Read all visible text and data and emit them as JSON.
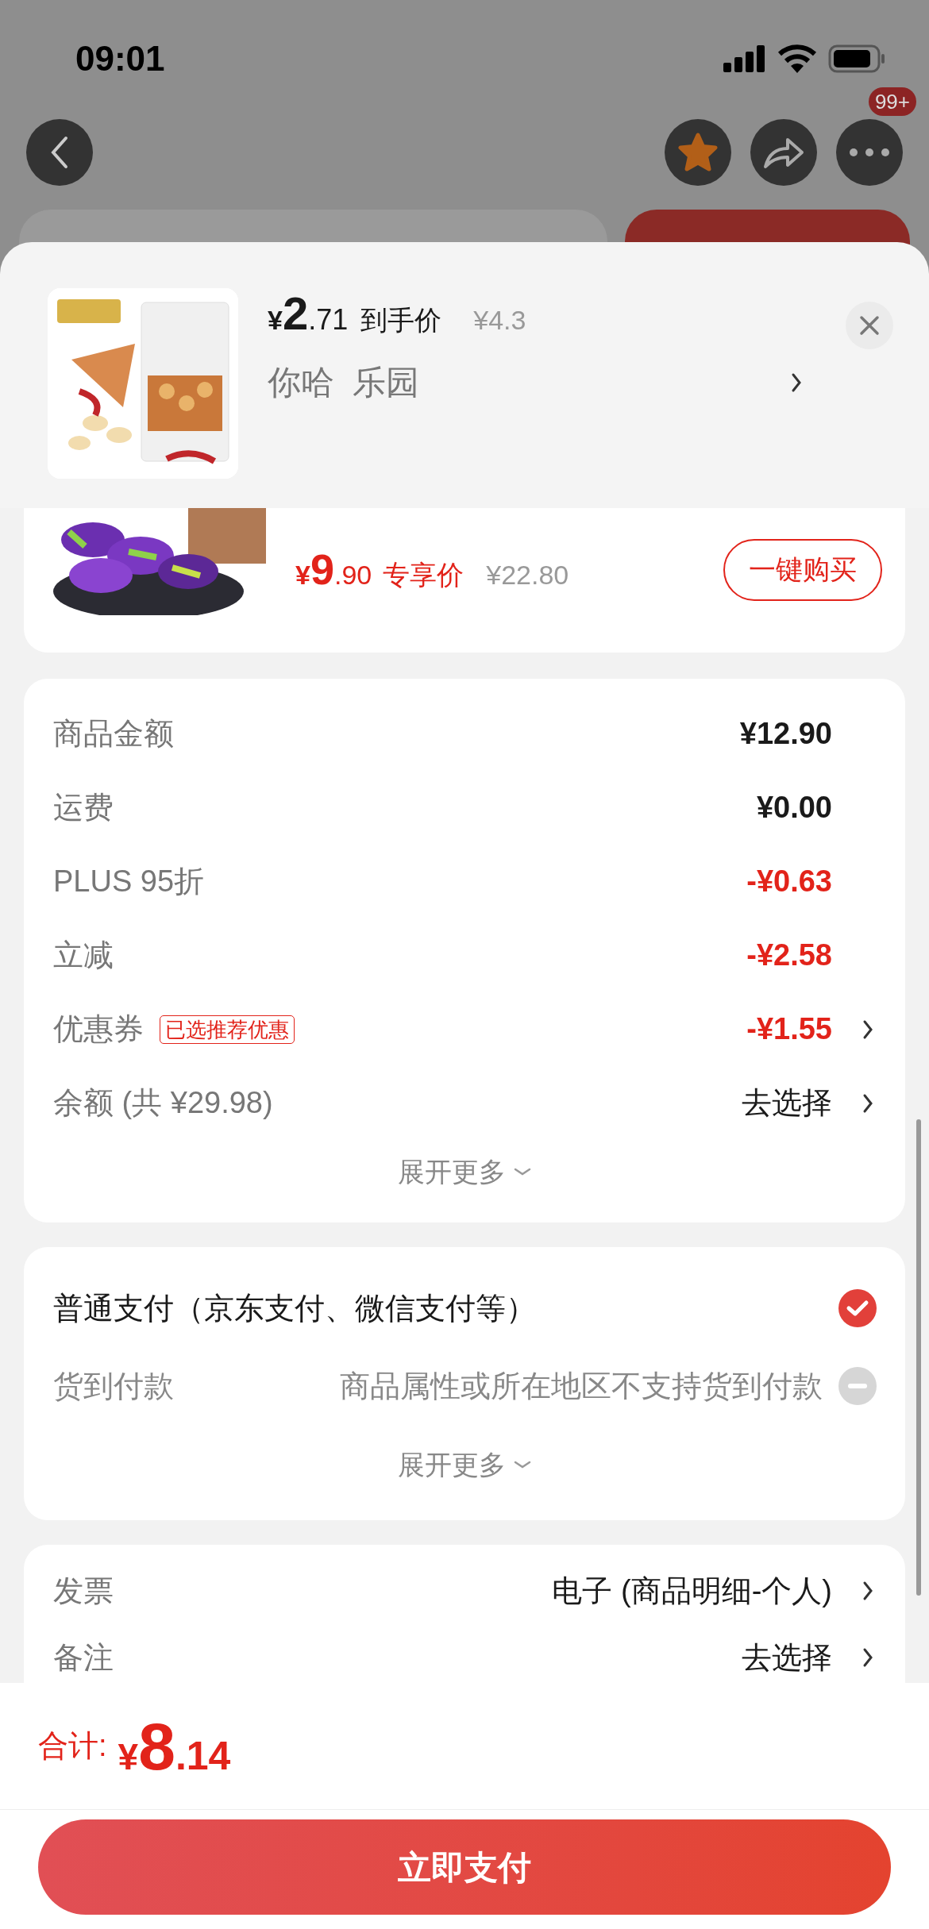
{
  "status_bar": {
    "time": "09:01"
  },
  "nav": {
    "badge": "99+"
  },
  "product": {
    "currency": "¥",
    "price_int": "2",
    "price_dec": ".71",
    "price_label": "到手价",
    "original_price": "¥4.3",
    "name": "你哈  乐园"
  },
  "deal": {
    "currency": "¥",
    "price_int": "9",
    "price_dec": ".90",
    "price_label": "专享价",
    "original_price": "¥22.80",
    "button": "一键购买"
  },
  "summary": {
    "rows": [
      {
        "label": "商品金额",
        "value": "¥12.90",
        "kind": "amount",
        "chevron": false
      },
      {
        "label": "运费",
        "value": "¥0.00",
        "kind": "amount",
        "chevron": false
      },
      {
        "label": "PLUS 95折",
        "value": "-¥0.63",
        "kind": "discount",
        "chevron": false
      },
      {
        "label": "立减",
        "value": "-¥2.58",
        "kind": "discount",
        "chevron": false
      },
      {
        "label": "优惠券",
        "tag": "已选推荐优惠",
        "value": "-¥1.55",
        "kind": "discount",
        "chevron": true
      },
      {
        "label": "余额 (共 ¥29.98)",
        "value": "去选择",
        "kind": "action",
        "chevron": true
      }
    ],
    "expand": "展开更多"
  },
  "payment": {
    "options": [
      {
        "label": "普通支付（京东支付、微信支付等）",
        "selected": true,
        "disabled": false
      },
      {
        "label": "货到付款",
        "note": "商品属性或所在地区不支持货到付款",
        "selected": false,
        "disabled": true
      }
    ],
    "expand": "展开更多"
  },
  "extras": {
    "rows": [
      {
        "label": "发票",
        "value": "电子 (商品明细-个人)"
      },
      {
        "label": "备注",
        "value": "去选择"
      }
    ]
  },
  "footer": {
    "total_label": "合计:",
    "currency": "¥",
    "total_int": "8",
    "total_dec": ".14",
    "pay_button": "立即支付"
  }
}
